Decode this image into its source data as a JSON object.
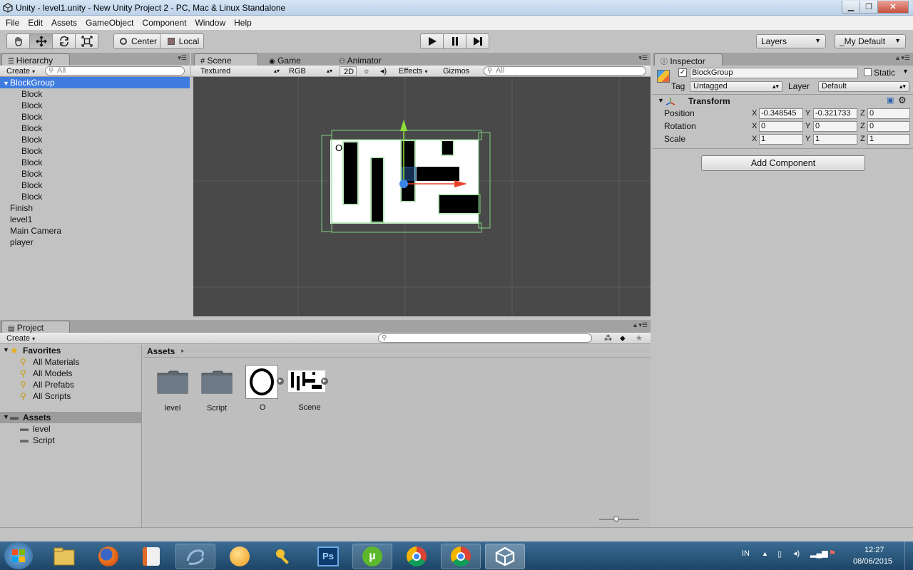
{
  "window": {
    "title": "Unity - level1.unity - New Unity Project 2 - PC, Mac & Linux Standalone",
    "minimize": "▁",
    "maximize": "❐",
    "close": "✕"
  },
  "menu": [
    "File",
    "Edit",
    "Assets",
    "GameObject",
    "Component",
    "Window",
    "Help"
  ],
  "toolbar": {
    "pivot_center": "Center",
    "pivot_local": "Local",
    "layers": "Layers",
    "layout": "_My Default"
  },
  "hierarchy": {
    "tab": "Hierarchy",
    "create": "Create",
    "search_placeholder": "All",
    "items": [
      {
        "label": "BlockGroup",
        "selected": true,
        "expanded": true,
        "child": false
      },
      {
        "label": "Block",
        "child": true
      },
      {
        "label": "Block",
        "child": true
      },
      {
        "label": "Block",
        "child": true
      },
      {
        "label": "Block",
        "child": true
      },
      {
        "label": "Block",
        "child": true
      },
      {
        "label": "Block",
        "child": true
      },
      {
        "label": "Block",
        "child": true
      },
      {
        "label": "Block",
        "child": true
      },
      {
        "label": "Block",
        "child": true
      },
      {
        "label": "Block",
        "child": true
      },
      {
        "label": "Finish",
        "child": false
      },
      {
        "label": "level1",
        "child": false
      },
      {
        "label": "Main Camera",
        "child": false
      },
      {
        "label": "player",
        "child": false
      }
    ]
  },
  "scene": {
    "tabs": [
      "Scene",
      "Game",
      "Animator"
    ],
    "shading": "Textured",
    "render_mode": "RGB",
    "mode_2d": "2D",
    "effects": "Effects",
    "gizmos": "Gizmos",
    "search_placeholder": "All",
    "player_label": "O"
  },
  "inspector": {
    "tab": "Inspector",
    "object_name": "BlockGroup",
    "static_label": "Static",
    "tag_label": "Tag",
    "tag_value": "Untagged",
    "layer_label": "Layer",
    "layer_value": "Default",
    "component": "Transform",
    "position_label": "Position",
    "rotation_label": "Rotation",
    "scale_label": "Scale",
    "axis_x": "X",
    "axis_y": "Y",
    "axis_z": "Z",
    "position": {
      "x": "-0.348545",
      "y": "-0.321733",
      "z": "0"
    },
    "rotation": {
      "x": "0",
      "y": "0",
      "z": "0"
    },
    "scale": {
      "x": "1",
      "y": "1",
      "z": "1"
    },
    "add_component": "Add Component"
  },
  "project": {
    "tab": "Project",
    "create": "Create",
    "favorites": "Favorites",
    "favorite_items": [
      "All Materials",
      "All Models",
      "All Prefabs",
      "All Scripts"
    ],
    "assets_root": "Assets",
    "asset_folders": [
      "level",
      "Script"
    ],
    "breadcrumb": "Assets",
    "assets": [
      "level",
      "Script",
      "O",
      "Scene"
    ]
  },
  "taskbar": {
    "lang": "IN",
    "time": "12:27",
    "date": "08/06/2015",
    "ps_label": "Ps"
  },
  "colors": {
    "selection": "#3e7ce0",
    "panel_bg": "#c2c2c2",
    "scene_bg": "#494949",
    "gizmo_y": "#8ee03a",
    "gizmo_x": "#e8442c",
    "gizmo_center": "#3a86e8"
  }
}
